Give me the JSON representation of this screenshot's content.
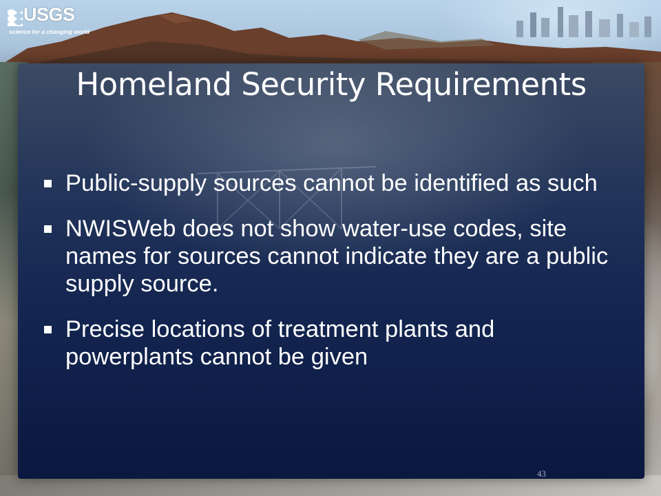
{
  "logo": {
    "name": "USGS",
    "tagline": "science for a changing world"
  },
  "slide": {
    "title": "Homeland Security Requirements",
    "bullets": [
      {
        "text": "Public-supply sources cannot be identified as such"
      },
      {
        "text": "NWISWeb does not show water-use codes, site names for sources cannot indicate they are a public supply source."
      },
      {
        "text": "Precise locations of treatment plants and powerplants cannot be given"
      }
    ],
    "page_number": "43"
  },
  "icons": {
    "bullet": "square-bullet-icon",
    "logo_mark": "usgs-wave-mark-icon"
  },
  "colors": {
    "text": "#ffffff",
    "content_background": "#132550",
    "page_number": "#a6b0c4"
  }
}
